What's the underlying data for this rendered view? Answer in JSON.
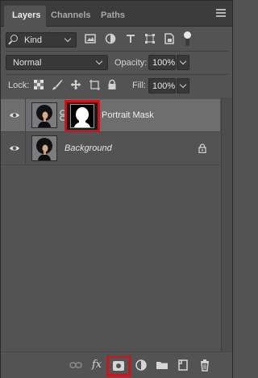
{
  "tabs": [
    {
      "label": "Layers",
      "active": true
    },
    {
      "label": "Channels",
      "active": false
    },
    {
      "label": "Paths",
      "active": false
    }
  ],
  "filter": {
    "kind_label": "Kind",
    "icons": [
      "pixel-filter-icon",
      "adjustment-filter-icon",
      "type-filter-icon",
      "shape-filter-icon",
      "smart-object-filter-icon"
    ]
  },
  "blend": {
    "mode": "Normal",
    "opacity_label": "Opacity:",
    "opacity_value": "100%",
    "fill_label": "Fill:",
    "fill_value": "100%"
  },
  "lock": {
    "label": "Lock:",
    "icons": [
      "lock-transparent-pixels-icon",
      "lock-image-pixels-icon",
      "lock-position-icon",
      "lock-artboard-icon",
      "lock-all-icon"
    ]
  },
  "layers": [
    {
      "name": "Portrait Mask",
      "selected": true,
      "has_mask": true,
      "locked": false,
      "italic": false
    },
    {
      "name": "Background",
      "selected": false,
      "has_mask": false,
      "locked": true,
      "italic": true
    }
  ],
  "bottom": {
    "fx_label": "fx",
    "icons": [
      "link-layers-icon",
      "add-layer-style-icon",
      "add-layer-mask-icon",
      "new-adjustment-layer-icon",
      "new-group-icon",
      "new-layer-icon",
      "delete-layer-icon"
    ]
  },
  "colors": {
    "panel_bg": "#535353",
    "selected_row": "#6e6e6e",
    "highlight": "#d4111b"
  }
}
